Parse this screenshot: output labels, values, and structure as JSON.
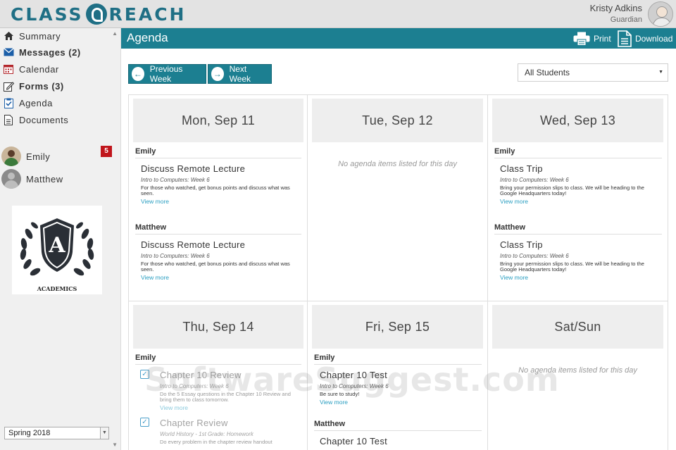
{
  "app": {
    "logo_left": "CLASS",
    "logo_right": "REACH"
  },
  "user": {
    "name": "Kristy Adkins",
    "role": "Guardian"
  },
  "nav": {
    "items": [
      {
        "label": "Summary",
        "icon": "home-icon"
      },
      {
        "label": "Messages (2)",
        "icon": "envelope-icon"
      },
      {
        "label": "Calendar",
        "icon": "calendar-icon"
      },
      {
        "label": "Forms (3)",
        "icon": "edit-form-icon"
      },
      {
        "label": "Agenda",
        "icon": "clipboard-check-icon"
      },
      {
        "label": "Documents",
        "icon": "document-icon"
      }
    ],
    "students": [
      {
        "name": "Emily",
        "badge": "5"
      },
      {
        "name": "Matthew",
        "badge": ""
      }
    ],
    "crest_label": "ACADEMICS",
    "term": "Spring 2018"
  },
  "main": {
    "title": "Agenda",
    "print_label": "Print",
    "download_label": "Download",
    "prev_week_label": "Previous Week",
    "next_week_label": "Next Week",
    "student_filter": "All Students"
  },
  "days": [
    {
      "title": "Mon, Sep 11",
      "empty": "",
      "sections": [
        {
          "student": "Emily",
          "items": [
            {
              "title": "Discuss Remote Lecture",
              "course": "Intro to Computers: Week 6",
              "desc": "For those who watched, get bonus points and discuss what was seen.",
              "more": "View more"
            }
          ]
        },
        {
          "student": "Matthew",
          "items": [
            {
              "title": "Discuss Remote Lecture",
              "course": "Intro to Computers: Week 6",
              "desc": "For those who watched, get bonus points and discuss what was seen.",
              "more": "View more"
            }
          ]
        }
      ]
    },
    {
      "title": "Tue, Sep 12",
      "empty": "No agenda items listed for this day",
      "sections": []
    },
    {
      "title": "Wed, Sep 13",
      "empty": "",
      "sections": [
        {
          "student": "Emily",
          "items": [
            {
              "title": "Class Trip",
              "course": "Intro to Computers: Week 6",
              "desc": "Bring your permission slips to class. We will be heading to the Google Headquarters today!",
              "more": "View more"
            }
          ]
        },
        {
          "student": "Matthew",
          "items": [
            {
              "title": "Class Trip",
              "course": "Intro to Computers: Week 6",
              "desc": "Bring your permission slips to class. We will be heading to the Google Headquarters today!",
              "more": "View more"
            }
          ]
        }
      ]
    },
    {
      "title": "Thu, Sep 14",
      "empty": "",
      "sections": [
        {
          "student": "Emily",
          "items": [
            {
              "title": "Chapter 10 Review",
              "course": "Intro to Computers: Week 6",
              "desc": "Do the 5 Essay questions in the Chapter 10 Review and bring them to class tomorrow.",
              "more": "View more",
              "done": true
            },
            {
              "title": "Chapter Review",
              "course": "World History - 1st Grade: Homework",
              "desc": "Do every problem in the chapter review handout",
              "more": "",
              "done": true
            }
          ]
        }
      ]
    },
    {
      "title": "Fri, Sep 15",
      "empty": "",
      "sections": [
        {
          "student": "Emily",
          "items": [
            {
              "title": "Chapter 10 Test",
              "course": "Intro to Computers: Week 6",
              "desc": "Be sure to study!",
              "more": "View more"
            }
          ]
        },
        {
          "student": "Matthew",
          "items": [
            {
              "title": "Chapter 10 Test",
              "course": "",
              "desc": "",
              "more": ""
            }
          ]
        }
      ]
    },
    {
      "title": "Sat/Sun",
      "empty": "No agenda items listed for this day",
      "sections": []
    }
  ],
  "watermark": "SoftwareSuggest.com",
  "colors": {
    "brand": "#1c7f91",
    "badge": "#c0151b",
    "link": "#2a9ec1"
  }
}
